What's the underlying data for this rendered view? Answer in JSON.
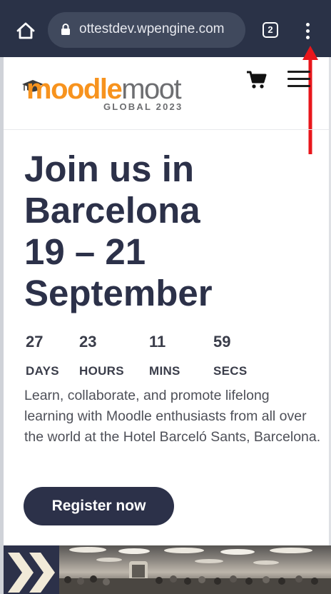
{
  "browser": {
    "url": "ottestdev.wpengine.com",
    "tab_count": "2"
  },
  "site": {
    "logo": {
      "word_primary": "moodle",
      "word_secondary": "moot",
      "subtitle": "GLOBAL 2023"
    }
  },
  "hero": {
    "title_lines": [
      "Join us in",
      "Barcelona",
      "19 – 21",
      "September"
    ],
    "countdown": [
      {
        "value": "27",
        "unit": "DAYS"
      },
      {
        "value": "23",
        "unit": "HOURS"
      },
      {
        "value": "11",
        "unit": "MINS"
      },
      {
        "value": "59",
        "unit": "SECS"
      }
    ],
    "intro": "Learn, collaborate, and promote lifelong learning with Moodle enthusiasts from all over the world at the Hotel Barceló Sants, Barcelona.",
    "cta_label": "Register now"
  },
  "colors": {
    "browser_bar": "#2a3247",
    "brand_orange": "#f7931e",
    "brand_navy": "#2c3149",
    "annotation_red": "#e8161b"
  },
  "icons": [
    "home-icon",
    "lock-icon",
    "tabs-icon",
    "more-vert-icon",
    "graduation-cap-icon",
    "cart-icon",
    "hamburger-icon",
    "chevrons-icon",
    "arrow-up-icon"
  ]
}
